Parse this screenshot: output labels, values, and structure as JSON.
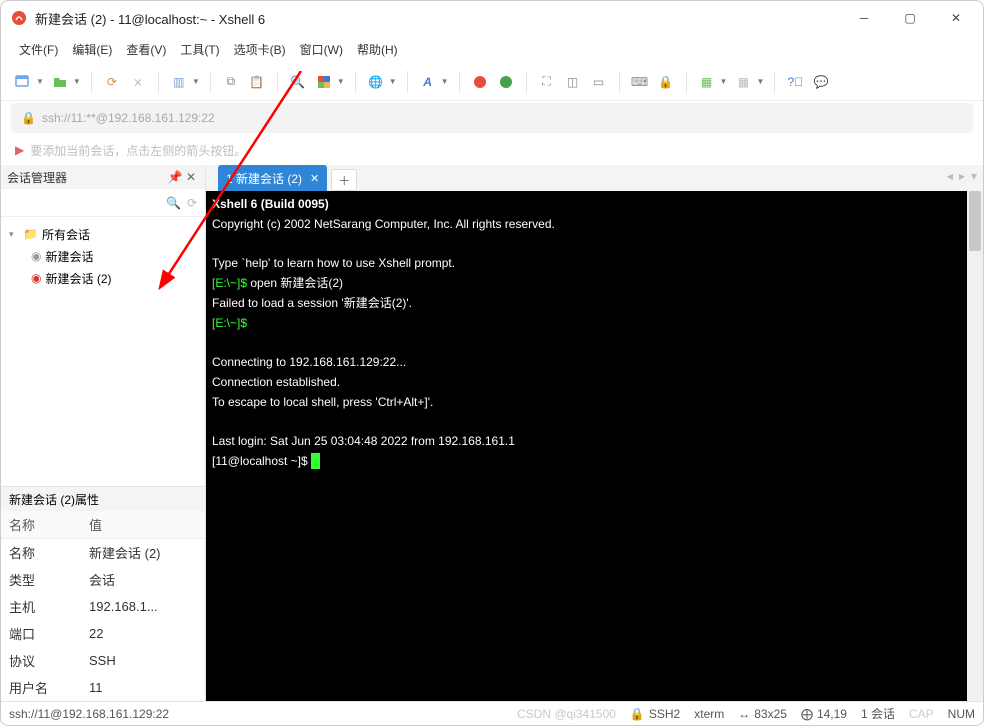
{
  "window": {
    "title": "新建会话 (2) - 11@localhost:~ - Xshell 6"
  },
  "menu": [
    "文件(F)",
    "编辑(E)",
    "查看(V)",
    "工具(T)",
    "选项卡(B)",
    "窗口(W)",
    "帮助(H)"
  ],
  "address": "ssh://11:**@192.168.161.129:22",
  "hint": "要添加当前会话，点击左侧的箭头按钮。",
  "sidebar": {
    "title": "会话管理器",
    "root": "所有会话",
    "items": [
      "新建会话",
      "新建会话 (2)"
    ]
  },
  "props": {
    "title": "新建会话 (2)属性",
    "cols": [
      "名称",
      "值"
    ],
    "rows": [
      [
        "名称",
        "新建会话 (2)"
      ],
      [
        "类型",
        "会话"
      ],
      [
        "主机",
        "192.168.1..."
      ],
      [
        "端口",
        "22"
      ],
      [
        "协议",
        "SSH"
      ],
      [
        "用户名",
        "11"
      ]
    ]
  },
  "tab": {
    "label": "1 新建会话 (2)"
  },
  "terminal": {
    "l1": "Xshell 6 (Build 0095)",
    "l2": "Copyright (c) 2002 NetSarang Computer, Inc. All rights reserved.",
    "l3": "Type `help' to learn how to use Xshell prompt.",
    "p1": "[E:\\~]$ ",
    "c1": "open 新建会话(2)",
    "l4": "Failed to load a session '新建会话(2)'.",
    "p2": "[E:\\~]$ ",
    "l5": "Connecting to 192.168.161.129:22...",
    "l6": "Connection established.",
    "l7": "To escape to local shell, press 'Ctrl+Alt+]'.",
    "l8": "Last login: Sat Jun 25 03:04:48 2022 from 192.168.161.1",
    "p3": "[11@localhost ~]$ "
  },
  "status": {
    "conn": "ssh://11@192.168.161.129:22",
    "proto": "SSH2",
    "term": "xterm",
    "size": "83x25",
    "pos": "14,19",
    "sess": "1 会话",
    "watermark": "CSDN @qi341500",
    "caps": "CAP",
    "num": "NUM"
  }
}
